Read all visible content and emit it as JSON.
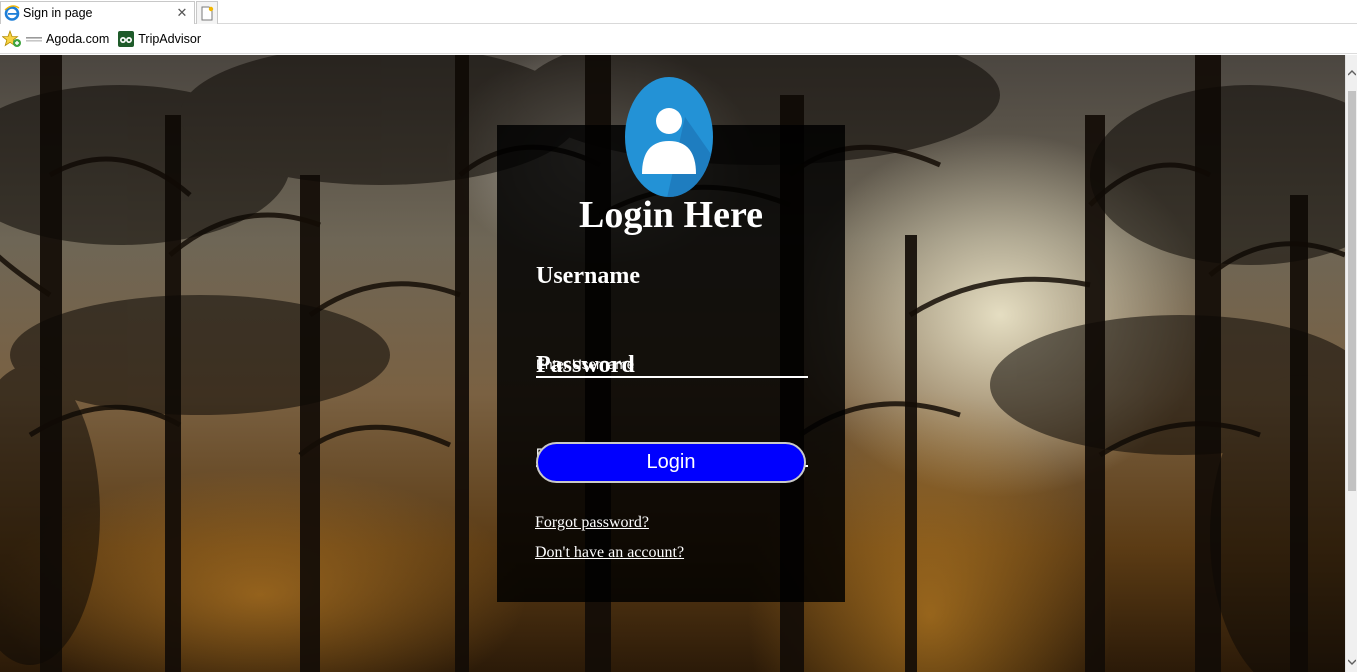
{
  "browser": {
    "tab_title": "Sign in page",
    "tab_close_glyph": "✕",
    "favorites": [
      {
        "label": "Agoda.com"
      },
      {
        "label": "TripAdvisor"
      }
    ],
    "accent": "#1e88e5"
  },
  "login": {
    "title": "Login Here",
    "username_label": "Username",
    "username_placeholder": "Enter Username",
    "password_label": "Password",
    "password_placeholder": "Enter Password",
    "button_label": "Login",
    "forgot_link": "Forgot password?",
    "signup_link": "Don't have an account?",
    "button_color": "#0000ff",
    "avatar_color": "#2392d6"
  }
}
